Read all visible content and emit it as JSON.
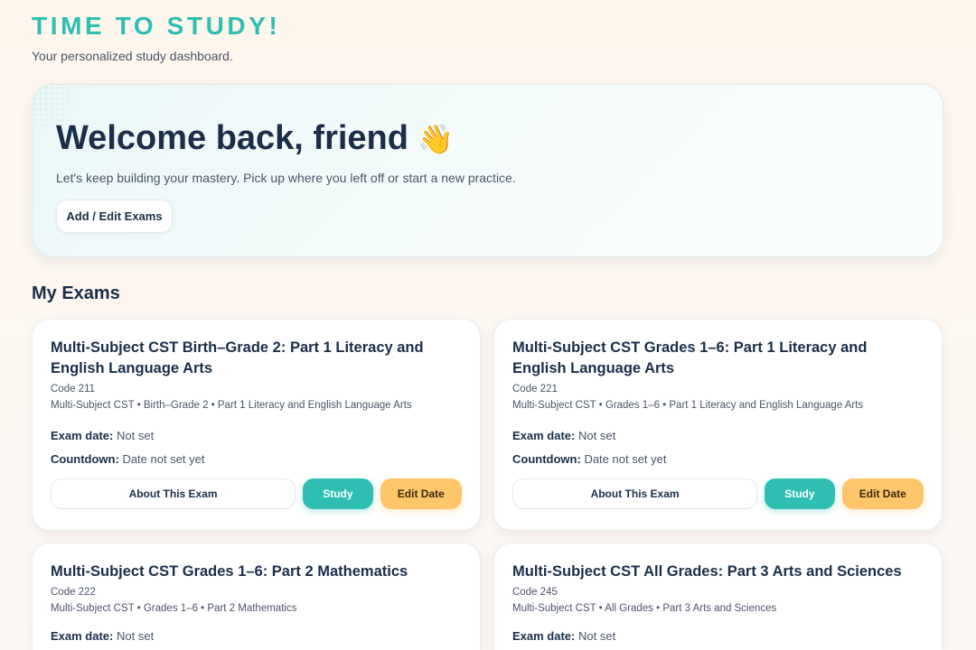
{
  "app": {
    "title": "TIME TO STUDY!",
    "subtitle": "Your personalized study dashboard."
  },
  "hero": {
    "heading": "Welcome back, friend",
    "wave_icon": "👋",
    "text": "Let's keep building your mastery. Pick up where you left off or start a new practice.",
    "add_edit_label": "Add / Edit Exams"
  },
  "section": {
    "my_exams": "My Exams"
  },
  "labels": {
    "exam_date": "Exam date:",
    "countdown": "Countdown:",
    "about": "About This Exam",
    "study": "Study",
    "edit_date": "Edit Date"
  },
  "exams": [
    {
      "title": "Multi-Subject CST Birth–Grade 2: Part 1 Literacy and English Language Arts",
      "code": "Code 211",
      "meta": "Multi-Subject CST • Birth–Grade 2 • Part 1 Literacy and English Language Arts",
      "exam_date": "Not set",
      "countdown": "Date not set yet"
    },
    {
      "title": "Multi-Subject CST Grades 1–6: Part 1 Literacy and English Language Arts",
      "code": "Code 221",
      "meta": "Multi-Subject CST • Grades 1–6 • Part 1 Literacy and English Language Arts",
      "exam_date": "Not set",
      "countdown": "Date not set yet"
    },
    {
      "title": "Multi-Subject CST Grades 1–6: Part 2 Mathematics",
      "code": "Code 222",
      "meta": "Multi-Subject CST • Grades 1–6 • Part 2 Mathematics",
      "exam_date": "Not set"
    },
    {
      "title": "Multi-Subject CST All Grades: Part 3 Arts and Sciences",
      "code": "Code 245",
      "meta": "Multi-Subject CST • All Grades • Part 3 Arts and Sciences",
      "exam_date": "Not set"
    }
  ]
}
